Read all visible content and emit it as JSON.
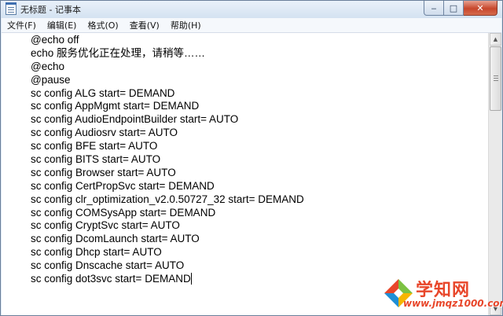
{
  "window": {
    "title": "无标题 - 记事本",
    "controls": {
      "minimize": "‒",
      "maximize": "□",
      "close": "✕"
    }
  },
  "menu": {
    "items": [
      "文件(F)",
      "编辑(E)",
      "格式(O)",
      "查看(V)",
      "帮助(H)"
    ]
  },
  "editor": {
    "lines": [
      "@echo off",
      "echo 服务优化正在处理，请稍等……",
      "@echo",
      "@pause",
      "sc config ALG start= DEMAND",
      "sc config AppMgmt start= DEMAND",
      "sc config AudioEndpointBuilder start= AUTO",
      "sc config Audiosrv start= AUTO",
      "sc config BFE start= AUTO",
      "sc config BITS start= AUTO",
      "sc config Browser start= AUTO",
      "sc config CertPropSvc start= DEMAND",
      "sc config clr_optimization_v2.0.50727_32 start= DEMAND",
      "sc config COMSysApp start= DEMAND",
      "sc config CryptSvc start= AUTO",
      "sc config DcomLaunch start= AUTO",
      "sc config Dhcp start= AUTO",
      "sc config Dnscache start= AUTO",
      "sc config dot3svc start= DEMAND"
    ]
  },
  "scrollbar": {
    "up_icon": "arrow-up-icon",
    "down_icon": "arrow-down-icon"
  },
  "watermark": {
    "title": "学知网",
    "url": "www.jmqz1000.com",
    "colors": {
      "red": "#e8462a",
      "blue": "#1f8fd6",
      "green": "#7cc242",
      "yellow": "#f7b500"
    }
  }
}
